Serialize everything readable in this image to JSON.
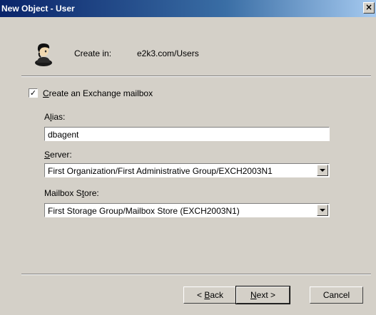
{
  "window": {
    "title": "New Object - User",
    "close_glyph": "×"
  },
  "header": {
    "icon": "user-icon",
    "create_in_label": "Create in:",
    "create_in_value": "e2k3.com/Users"
  },
  "exchange": {
    "checkbox_checked": true,
    "checkbox_mark": "✓",
    "checkbox_label": "Create an Exchange mailbox",
    "alias_label": "Alias:",
    "alias_value": "dbagent",
    "server_label": "Server:",
    "server_value": "First Organization/First Administrative Group/EXCH2003N1",
    "store_label": "Mailbox Store:",
    "store_value": "First Storage Group/Mailbox Store (EXCH2003N1)"
  },
  "buttons": {
    "back": "< Back",
    "next": "Next >",
    "cancel": "Cancel"
  },
  "colors": {
    "face": "#d4d0c8",
    "title_start": "#0a246a",
    "title_end": "#a6caf0"
  }
}
